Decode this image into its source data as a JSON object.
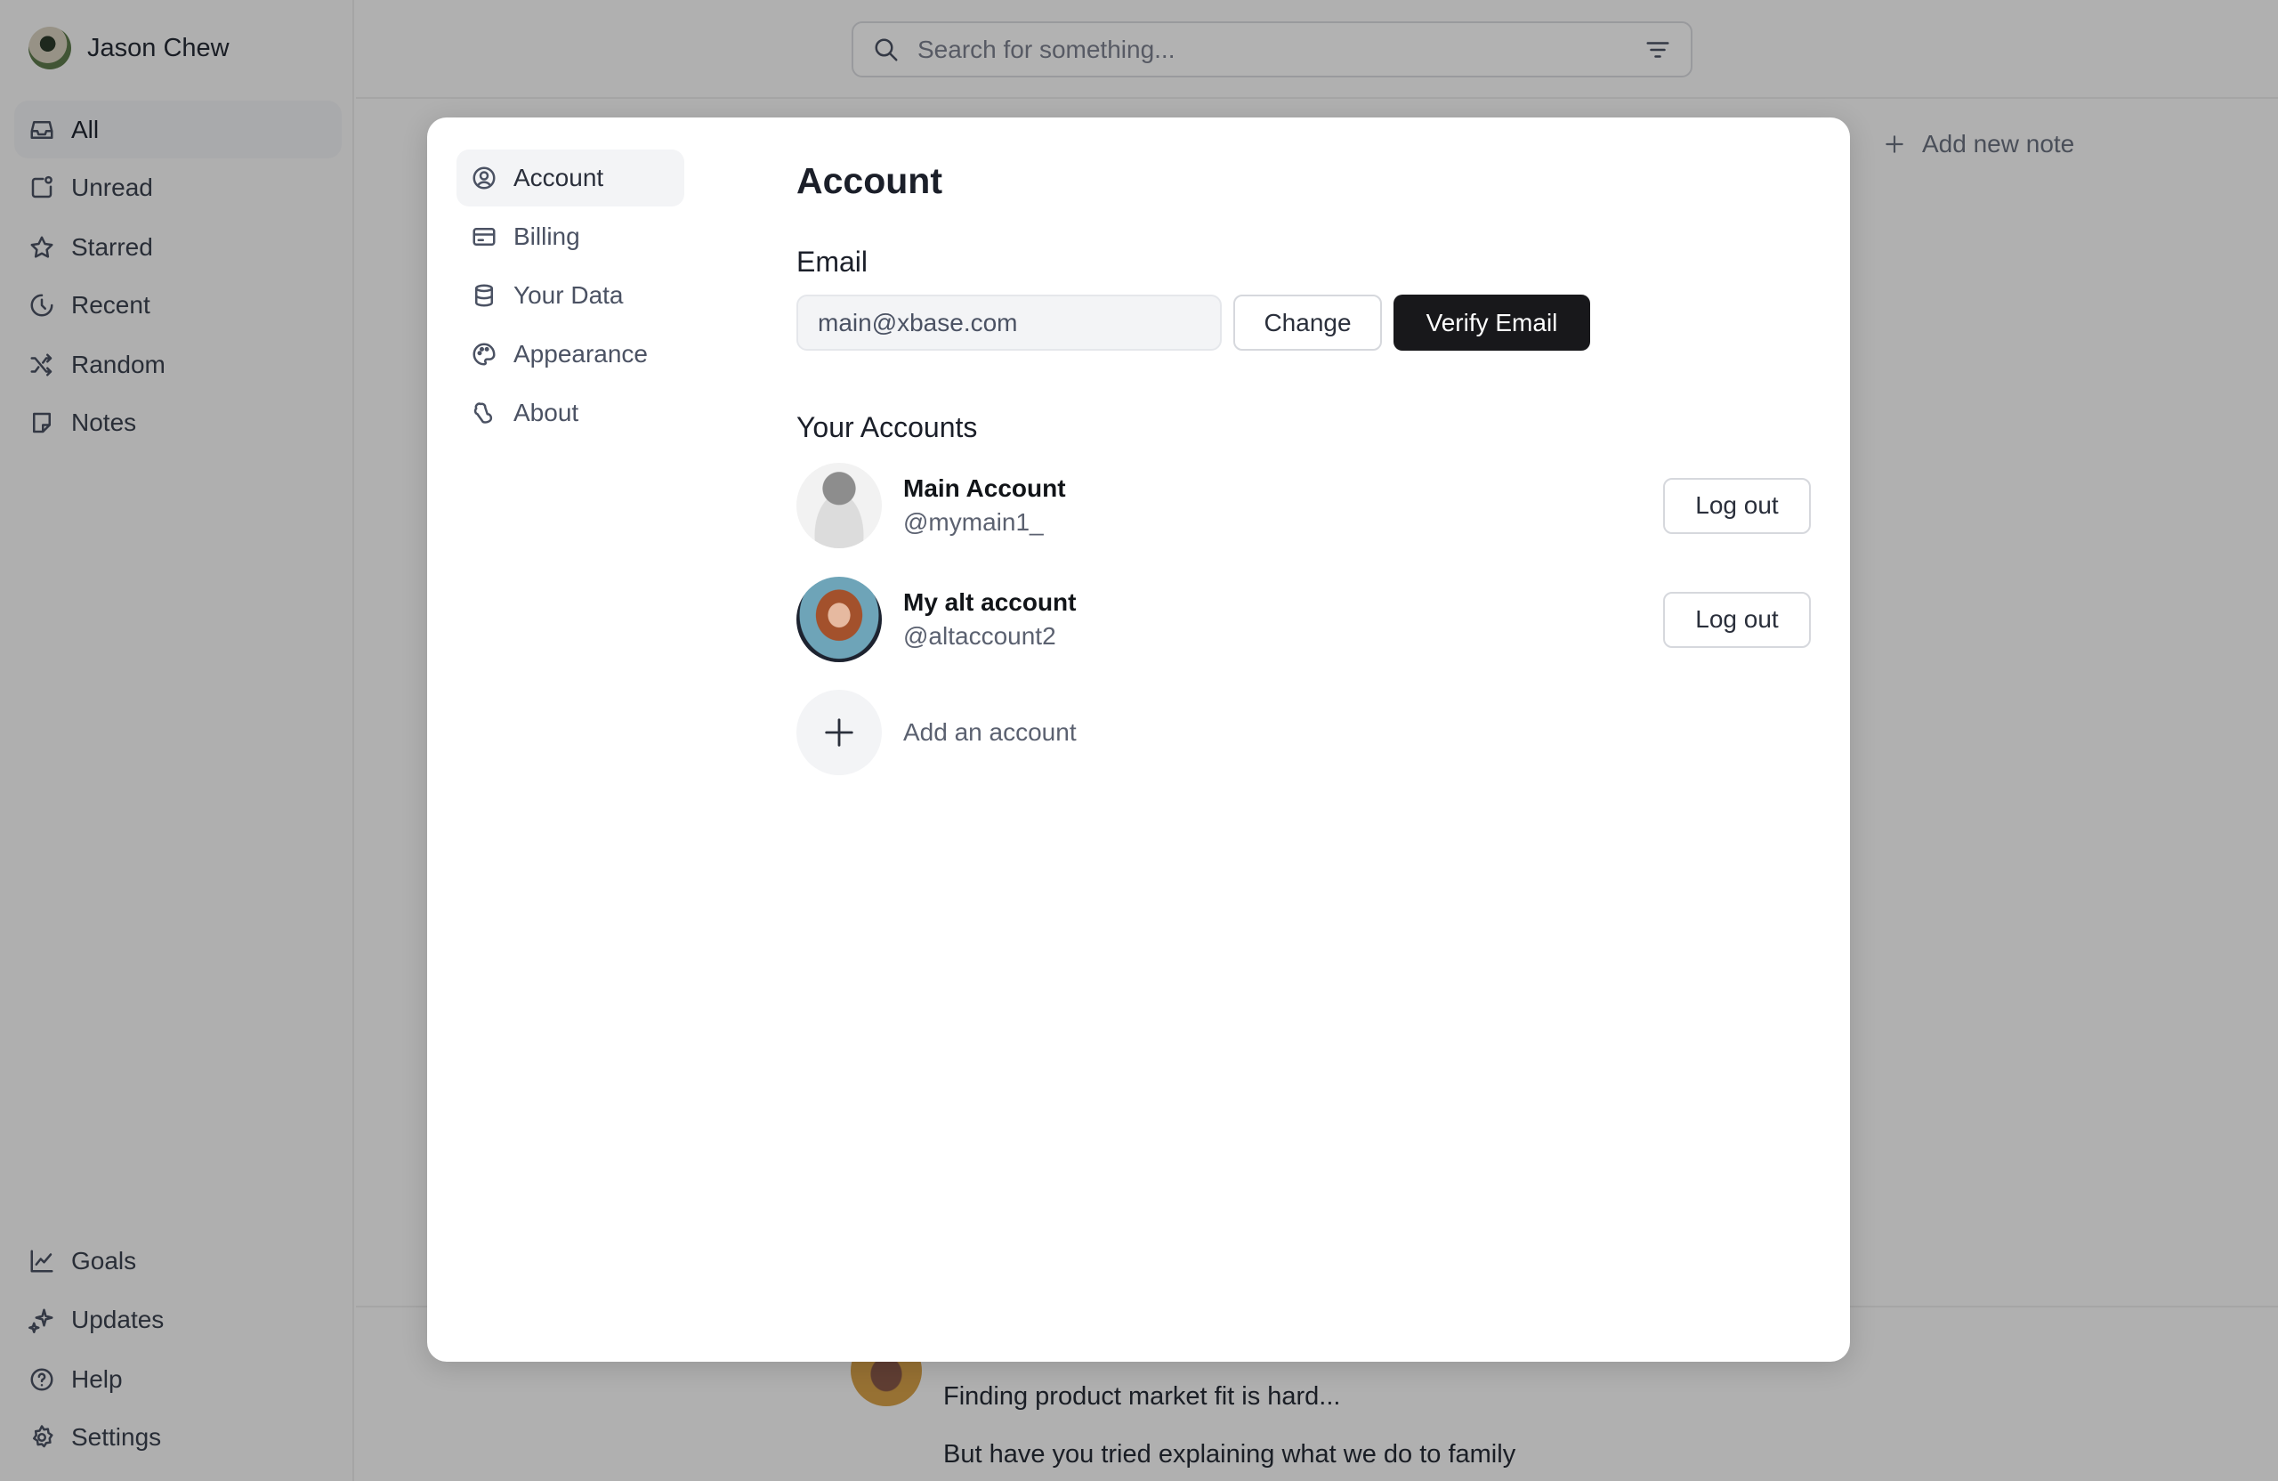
{
  "sidebar": {
    "user_name": "Jason Chew",
    "items": [
      {
        "label": "All",
        "icon": "inbox-icon",
        "active": true
      },
      {
        "label": "Unread",
        "icon": "unread-icon"
      },
      {
        "label": "Starred",
        "icon": "star-icon"
      },
      {
        "label": "Recent",
        "icon": "clock-icon"
      },
      {
        "label": "Random",
        "icon": "shuffle-icon"
      },
      {
        "label": "Notes",
        "icon": "note-icon"
      }
    ],
    "bottom_items": [
      {
        "label": "Goals",
        "icon": "chart-icon"
      },
      {
        "label": "Updates",
        "icon": "sparkle-icon"
      },
      {
        "label": "Help",
        "icon": "help-icon"
      },
      {
        "label": "Settings",
        "icon": "gear-icon"
      }
    ]
  },
  "header": {
    "search_placeholder": "Search for something...",
    "add_note": "Add new note"
  },
  "feed": {
    "line1": "Finding product market fit is hard...",
    "line2": "But have you tried explaining what we do to family"
  },
  "modal": {
    "nav": [
      {
        "label": "Account",
        "icon": "user-circle-icon",
        "active": true
      },
      {
        "label": "Billing",
        "icon": "credit-card-icon"
      },
      {
        "label": "Your Data",
        "icon": "database-icon"
      },
      {
        "label": "Appearance",
        "icon": "palette-icon"
      },
      {
        "label": "About",
        "icon": "about-icon"
      }
    ],
    "title": "Account",
    "email_label": "Email",
    "email_value": "main@xbase.com",
    "change_label": "Change",
    "verify_label": "Verify Email",
    "accounts_label": "Your Accounts",
    "accounts": [
      {
        "name": "Main Account",
        "handle": "@mymain1_",
        "action": "Log out"
      },
      {
        "name": "My alt account",
        "handle": "@altaccount2",
        "action": "Log out"
      }
    ],
    "add_account": "Add an account"
  }
}
